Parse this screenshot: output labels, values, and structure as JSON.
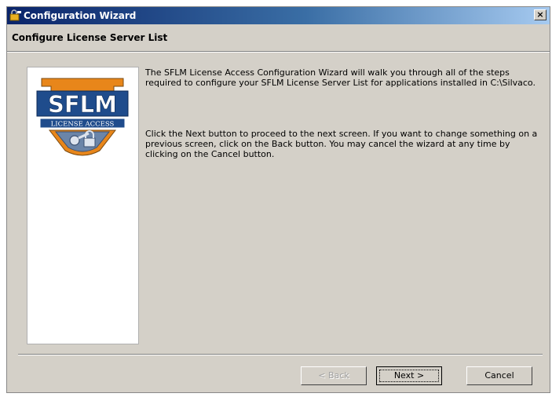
{
  "window": {
    "title": "Configuration Wizard",
    "close_glyph": "×"
  },
  "header": {
    "title": "Configure License Server List"
  },
  "logo": {
    "brand": "SFLM",
    "subtitle": "LICENSE ACCESS",
    "colors": {
      "orange": "#e8861a",
      "blue": "#1f4c8c",
      "steel": "#6b85a8"
    }
  },
  "content": {
    "paragraph1": "The SFLM License Access Configuration Wizard will walk you through all of the steps required to configure your SFLM License Server List for applications installed in C:\\Silvaco.",
    "paragraph2": "Click the Next button to proceed to the next screen. If you want to change something on a previous screen, click on the Back button. You may cancel the wizard at any time by clicking on the Cancel button."
  },
  "buttons": {
    "back_label": "< Back",
    "next_label": "Next >",
    "cancel_label": "Cancel"
  }
}
